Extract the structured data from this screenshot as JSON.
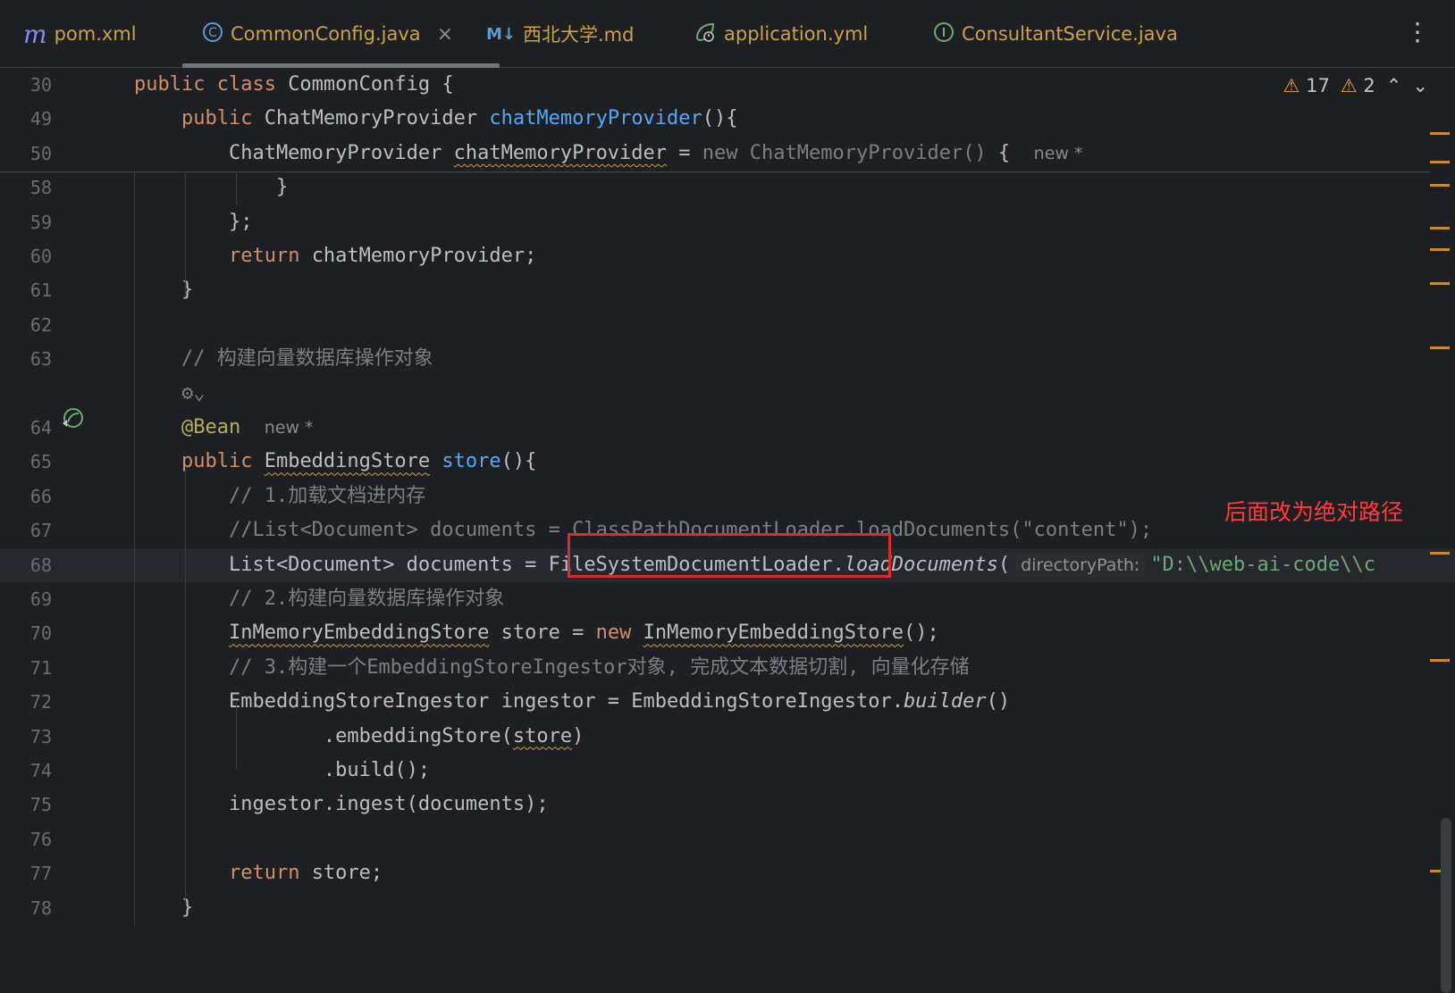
{
  "tabs": [
    {
      "icon": "m",
      "label": "pom.xml",
      "active": false
    },
    {
      "icon": "C",
      "label": "CommonConfig.java",
      "active": true
    },
    {
      "icon": "M↓",
      "label": "西北大学.md",
      "active": false
    },
    {
      "icon": "leaf",
      "label": "application.yml",
      "active": false
    },
    {
      "icon": "I",
      "label": "ConsultantService.java",
      "active": false
    }
  ],
  "tab_close": "×",
  "more_menu": "⋮",
  "inspections": {
    "warnings": "17",
    "weak_warnings": "2",
    "up": "⌃",
    "down": "⌄"
  },
  "lines": [
    {
      "n": "30",
      "parts": [
        {
          "t": "public class ",
          "c": "kw"
        },
        {
          "t": "CommonConfig {"
        }
      ]
    },
    {
      "n": "49",
      "parts": [
        {
          "t": "    "
        },
        {
          "t": "public ",
          "c": "kw"
        },
        {
          "t": "ChatMemoryProvider "
        },
        {
          "t": "chatMemoryProvider",
          "c": "fn"
        },
        {
          "t": "(){"
        }
      ]
    },
    {
      "n": "50",
      "parts": [
        {
          "t": "        ChatMemoryProvider "
        },
        {
          "t": "chatMemoryProvider",
          "c": "wavy"
        },
        {
          "t": " = "
        },
        {
          "t": "new ChatMemoryProvider()",
          "c": "gray"
        },
        {
          "t": " {  "
        },
        {
          "t": "new *",
          "c": "hint"
        }
      ]
    },
    {
      "n": "58",
      "parts": [
        {
          "t": "            }"
        }
      ]
    },
    {
      "n": "59",
      "parts": [
        {
          "t": "        };"
        }
      ]
    },
    {
      "n": "60",
      "parts": [
        {
          "t": "        "
        },
        {
          "t": "return ",
          "c": "kw"
        },
        {
          "t": "chatMemoryProvider;"
        }
      ]
    },
    {
      "n": "61",
      "parts": [
        {
          "t": "    }"
        }
      ]
    },
    {
      "n": "62",
      "parts": []
    },
    {
      "n": "63",
      "parts": [
        {
          "t": "    "
        },
        {
          "t": "// 构建向量数据库操作对象",
          "c": "cm"
        }
      ]
    },
    {
      "n": "",
      "parts": [
        {
          "t": "    "
        },
        {
          "t": "⚙⌄",
          "c": "gray"
        }
      ]
    },
    {
      "n": "64",
      "parts": [
        {
          "t": "    "
        },
        {
          "t": "@Bean",
          "c": "ann"
        },
        {
          "t": "  "
        },
        {
          "t": "new *",
          "c": "hint"
        }
      ]
    },
    {
      "n": "65",
      "parts": [
        {
          "t": "    "
        },
        {
          "t": "public ",
          "c": "kw"
        },
        {
          "t": "EmbeddingStore",
          "c": "wavy"
        },
        {
          "t": " "
        },
        {
          "t": "store",
          "c": "fn"
        },
        {
          "t": "(){"
        }
      ]
    },
    {
      "n": "66",
      "parts": [
        {
          "t": "        "
        },
        {
          "t": "// 1.加载文档进内存",
          "c": "cm"
        }
      ]
    },
    {
      "n": "67",
      "parts": [
        {
          "t": "        "
        },
        {
          "t": "//List<Document> documents = ClassPathDocumentLoader.loadDocuments(\"content\");",
          "c": "cm"
        }
      ]
    },
    {
      "n": "68",
      "parts": [
        {
          "t": "        List<Document> documents = FileSystemDocumentLoader."
        },
        {
          "t": "loadDocuments",
          "c": "it"
        },
        {
          "t": "("
        },
        {
          "t": "directoryPath:",
          "c": "hintbox"
        },
        {
          "t": "\"D:\\\\web-ai-code\\\\c",
          "c": "str"
        }
      ]
    },
    {
      "n": "69",
      "parts": [
        {
          "t": "        "
        },
        {
          "t": "// 2.构建向量数据库操作对象",
          "c": "cm"
        }
      ]
    },
    {
      "n": "70",
      "parts": [
        {
          "t": "        "
        },
        {
          "t": "InMemoryEmbeddingStore",
          "c": "wavy"
        },
        {
          "t": " store = "
        },
        {
          "t": "new ",
          "c": "kw"
        },
        {
          "t": "InMemoryEmbeddingStore",
          "c": "wavy"
        },
        {
          "t": "();"
        }
      ]
    },
    {
      "n": "71",
      "parts": [
        {
          "t": "        "
        },
        {
          "t": "// 3.构建一个EmbeddingStoreIngestor对象, 完成文本数据切割, 向量化存储",
          "c": "cm"
        }
      ]
    },
    {
      "n": "72",
      "parts": [
        {
          "t": "        EmbeddingStoreIngestor ingestor = EmbeddingStoreIngestor."
        },
        {
          "t": "builder",
          "c": "it"
        },
        {
          "t": "()"
        }
      ]
    },
    {
      "n": "73",
      "parts": [
        {
          "t": "                .embeddingStore("
        },
        {
          "t": "store",
          "c": "wavy"
        },
        {
          "t": ")"
        }
      ]
    },
    {
      "n": "74",
      "parts": [
        {
          "t": "                .build();"
        }
      ]
    },
    {
      "n": "75",
      "parts": [
        {
          "t": "        ingestor.ingest(documents);"
        }
      ]
    },
    {
      "n": "76",
      "parts": []
    },
    {
      "n": "77",
      "parts": [
        {
          "t": "        "
        },
        {
          "t": "return ",
          "c": "kw"
        },
        {
          "t": "store;"
        }
      ]
    },
    {
      "n": "78",
      "parts": [
        {
          "t": "    }"
        }
      ]
    }
  ],
  "annotation_note": "后面改为绝对路径",
  "colors": {
    "keyword": "#cf8e6d",
    "method": "#56a8f5",
    "comment": "#7a7e85",
    "string": "#6aab73",
    "annotation": "#b3ae60",
    "highlight_box": "#e0282e"
  }
}
